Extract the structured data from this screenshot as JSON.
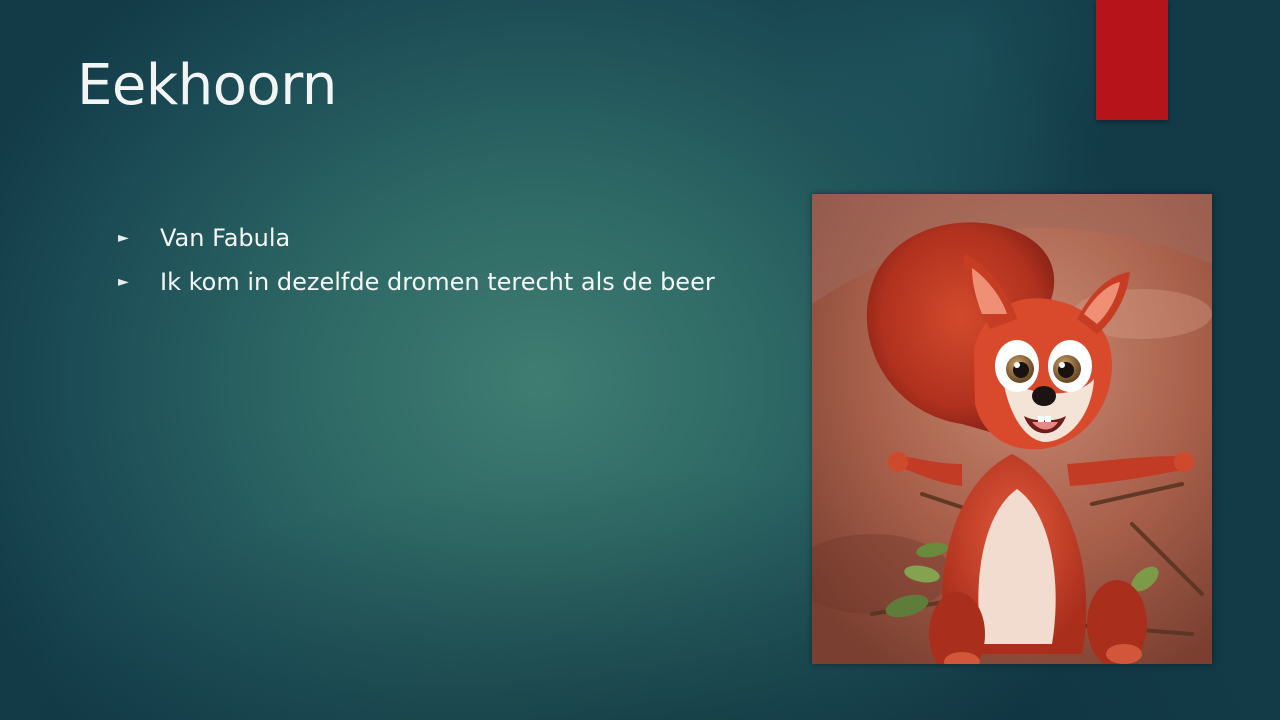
{
  "slide": {
    "title": "Eekhoorn",
    "bullets": [
      {
        "icon": "arrow-bullet-icon",
        "text": "Van Fabula"
      },
      {
        "icon": "arrow-bullet-icon",
        "text": "Ik kom in dezelfde dromen terecht als de beer"
      }
    ],
    "image": {
      "icon": "squirrel-illustration"
    }
  },
  "colors": {
    "accent": "#b5151a",
    "background": "#2f6a66",
    "text": "#f2f5f4"
  }
}
